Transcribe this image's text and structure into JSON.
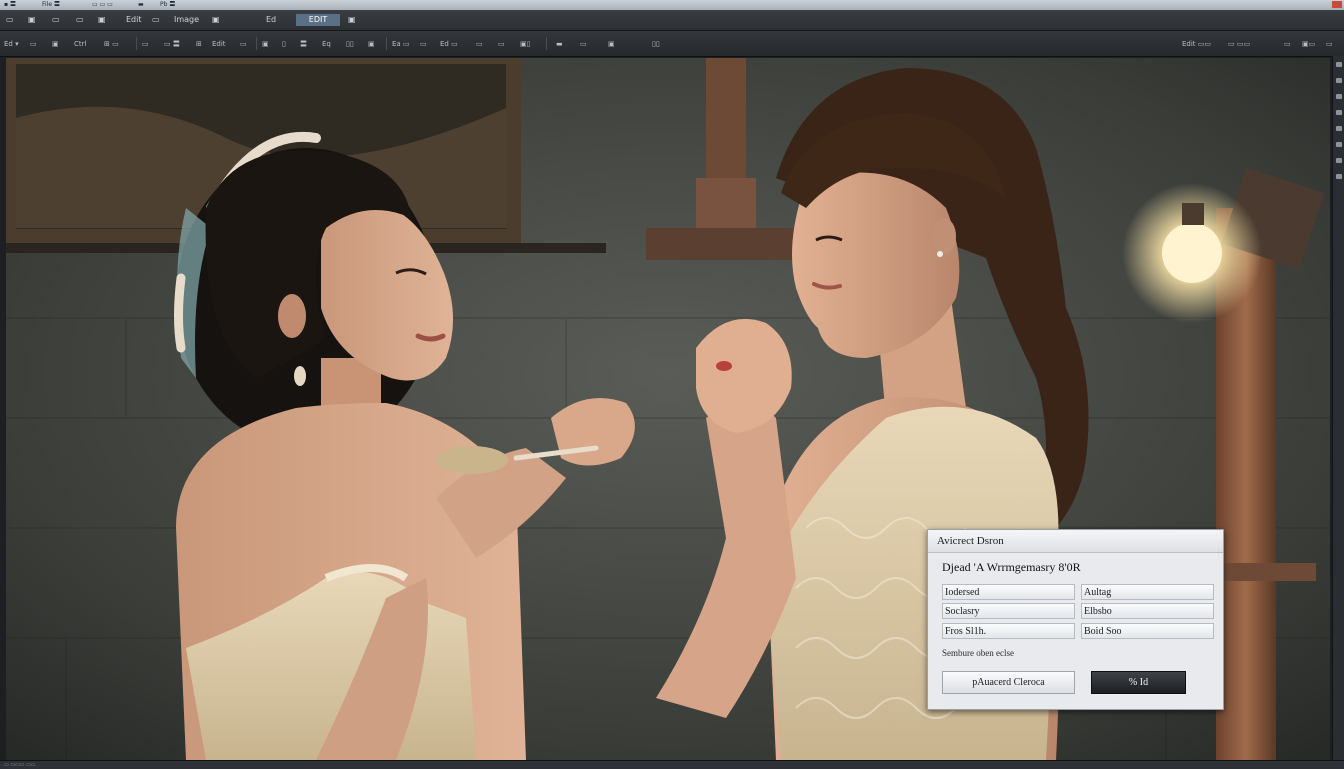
{
  "titlebar": {
    "items": [
      "▪ 〓",
      "File 〓",
      "▭ ▭ ▭",
      "▬",
      "Pb 〓"
    ]
  },
  "menubar": {
    "items": [
      "▭",
      "▣",
      "▭",
      "▭",
      "▣",
      "Edit",
      "▭",
      "Image",
      "▣",
      "Ed",
      "EDIT",
      "▣"
    ],
    "active_index": 10
  },
  "optionsbar": {
    "left_items": [
      "Ed ▾",
      "▭",
      "▣",
      "Ctrl",
      "⊞ ▭",
      "▭",
      "▭ 〓",
      "⊞",
      "Edit",
      "▭",
      "▣",
      "▯",
      "〓",
      "Eq",
      "▯▯",
      "▣",
      "Ea ▭",
      "▭",
      "Ed ▭",
      "▭",
      "▭",
      "▣▯",
      "▬",
      "▭",
      "▣",
      "▯▯"
    ],
    "right_items": [
      "Edit ▭▭",
      "▭ ▭▭",
      "▭",
      "▣▭",
      "▭"
    ]
  },
  "dialog": {
    "title": "Avicrect Dsron",
    "heading": "Djead 'A Wrrmgemasry 8'0R",
    "fields": [
      {
        "label": "Iodersed",
        "col": 0
      },
      {
        "label": "Aultag",
        "col": 1
      },
      {
        "label": "Soclasry",
        "col": 0
      },
      {
        "label": "Elbsbo",
        "col": 1
      },
      {
        "label": "Fros Sl1h.",
        "col": 0
      },
      {
        "label": "Boid Soo",
        "col": 1
      }
    ],
    "note": "Sembure oben eclse",
    "secondary_button": "pAuacerd Cleroca",
    "primary_button": "% Id"
  },
  "statusbar": {
    "text": "▭ ▭▭▭ ▭▭"
  },
  "colors": {
    "chrome_dark": "#2c2f33",
    "menu_active": "#5b6f86",
    "dialog_bg": "#e8eaed",
    "primary_button": "#1c1e21"
  }
}
